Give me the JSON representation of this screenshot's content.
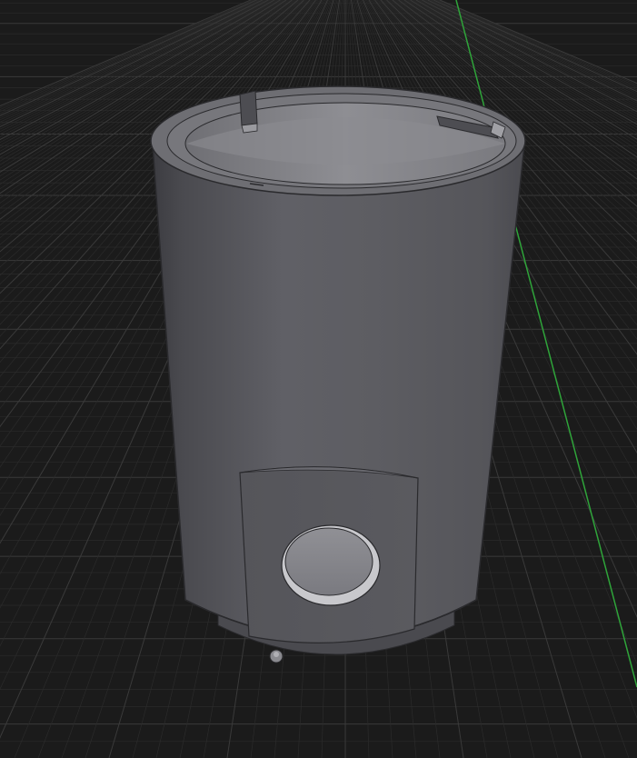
{
  "viewport": {
    "background_color": "#1b1b1b",
    "grid_minor_color": "#2b2b2b",
    "grid_major_color": "#3a3a3a",
    "axis_color": "#2fa43a"
  },
  "model": {
    "body_color": "#5d5d62",
    "body_shadow_color": "#3f3f44",
    "rim_color": "#6e6e73",
    "interior_color": "#8a8a8f",
    "edge_color": "#2a2a2d",
    "icons": [
      "cylinder-body",
      "rim",
      "notch",
      "flat-pad",
      "round-boss",
      "pin"
    ]
  }
}
